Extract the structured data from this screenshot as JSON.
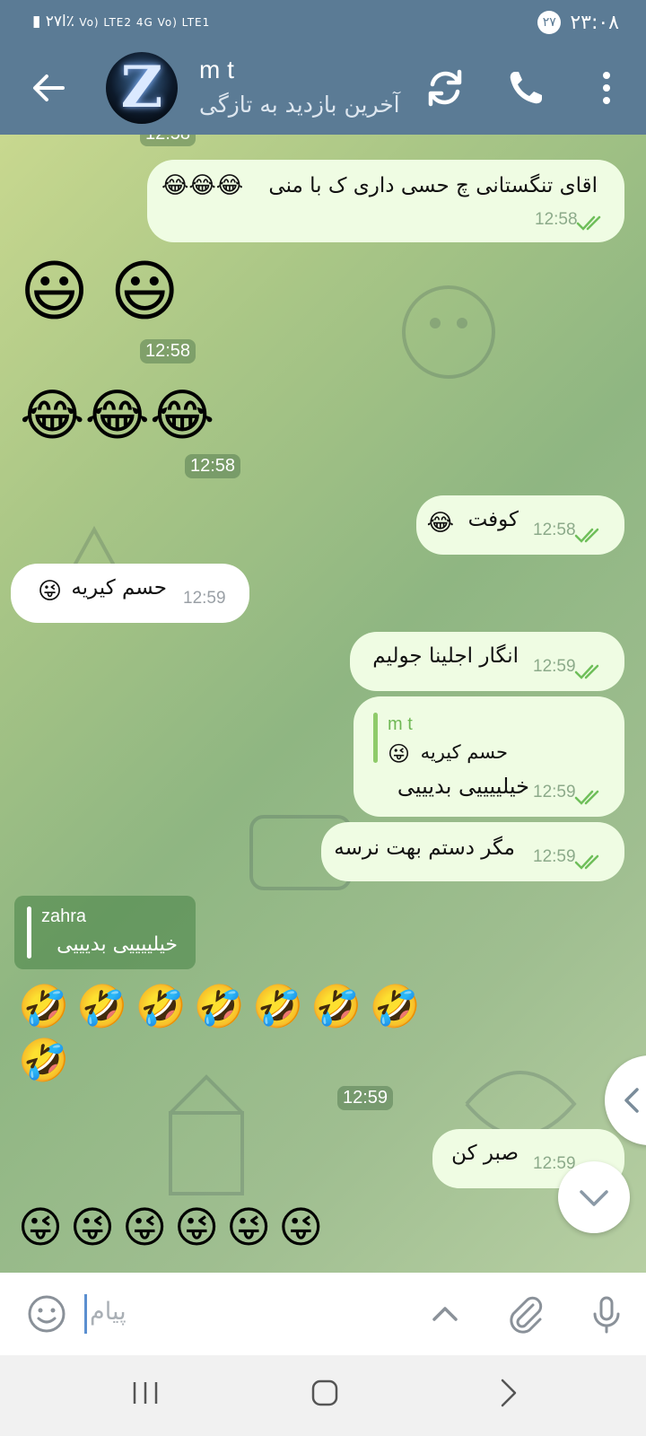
{
  "status_bar": {
    "left_text": "ا٢٧٪",
    "network": "Vo) LTE2  4G Vo) LTE1",
    "time": "٢٣:٠٨",
    "badge": "٢٧"
  },
  "header": {
    "title": "m t",
    "subtitle": "آخرین بازدید به تازگی",
    "avatar_letter": "Z"
  },
  "messages": {
    "top_partial_time": "12:58",
    "m1": {
      "text": "اقای تنگستانی چ حسی داری ک با منی",
      "time": "12:58"
    },
    "m2": {
      "time": "12:58"
    },
    "m3": {
      "time": "12:58"
    },
    "m4": {
      "text": "کوفت",
      "time": "12:58"
    },
    "m5": {
      "text": "حسم کیریه",
      "time": "12:59"
    },
    "m6": {
      "text": "انگار اجلینا جولیم",
      "time": "12:59"
    },
    "m7": {
      "quote_name": "m t",
      "quote_text": "حسم کیریه",
      "text": "خیلییییی بدیییی",
      "time": "12:59"
    },
    "m8": {
      "text": "مگر دستم بهت نرسه",
      "time": "12:59"
    },
    "m9": {
      "quote_name": "zahra",
      "quote_text": "خیلییییی بدیییی",
      "time": "12:59"
    },
    "m10": {
      "text": "صبر کن",
      "time": "12:59"
    }
  },
  "input": {
    "placeholder": "پیام"
  },
  "icons": [
    "back-arrow-icon",
    "refresh-icon",
    "phone-icon",
    "more-vertical-icon",
    "smiley-icon",
    "chevron-up-icon",
    "paperclip-icon",
    "microphone-icon",
    "chevron-left-icon",
    "chevron-down-icon"
  ],
  "colors": {
    "header": "#5b7b95",
    "outgoing_bubble": "#effce3",
    "incoming_bubble": "#ffffff",
    "ticks": "#6fbf5a"
  }
}
